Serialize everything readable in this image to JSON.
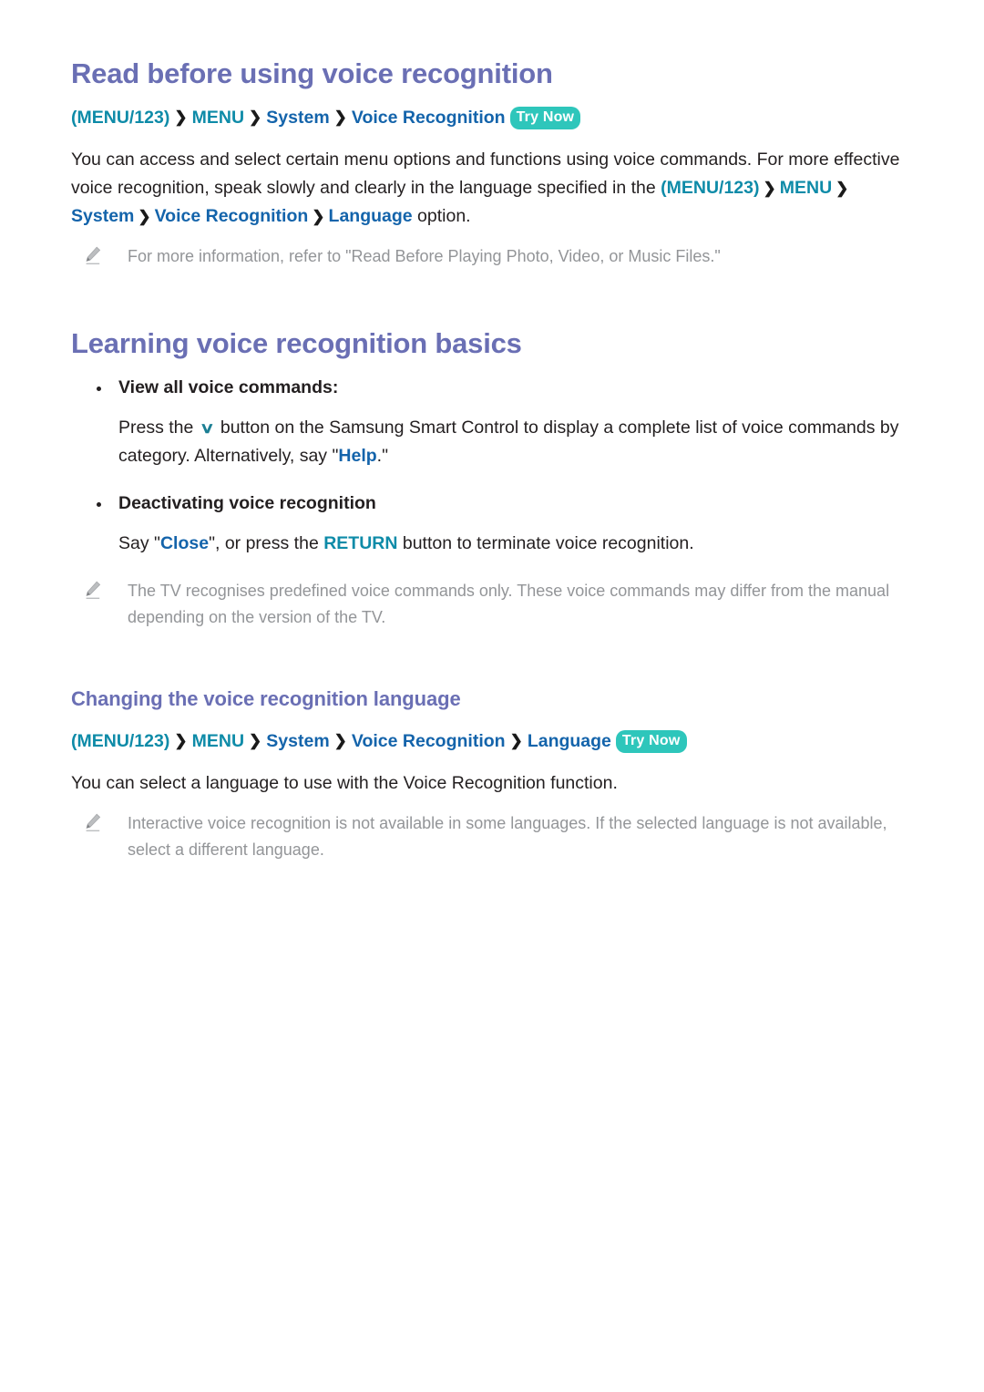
{
  "document": {
    "sections": [
      {
        "id": "read-before",
        "heading": "Read before using voice recognition",
        "breadcrumb": {
          "parts": [
            {
              "text": "(MENU/123)",
              "style": "teal"
            },
            {
              "text": "MENU",
              "style": "teal"
            },
            {
              "text": "System",
              "style": "blue"
            },
            {
              "text": "Voice Recognition",
              "style": "blue"
            }
          ],
          "separator": "❯",
          "badge": "Try Now"
        },
        "paragraph": {
          "lead": "You can access and select certain menu options and functions using voice commands. For more effective voice recognition, speak slowly and clearly in the language specified in the ",
          "path": [
            {
              "text": "(MENU/123)",
              "style": "teal"
            },
            {
              "text": "MENU",
              "style": "teal"
            },
            {
              "text": "System",
              "style": "blue"
            },
            {
              "text": "Voice Recognition",
              "style": "blue"
            },
            {
              "text": "Language",
              "style": "blue"
            }
          ],
          "tail": " option."
        },
        "note": "For more information, refer to \"Read Before Playing Photo, Video, or Music Files.\""
      },
      {
        "id": "learning-basics",
        "heading": "Learning voice recognition basics",
        "bullets": [
          {
            "label": "View all voice commands:",
            "body_before": "Press the ",
            "glyph": "∨",
            "body_mid": " button on the Samsung Smart Control to display a complete list of voice commands by category. Alternatively, say \"",
            "highlight": "Help",
            "highlight_style": "blue",
            "body_after": ".\""
          },
          {
            "label": "Deactivating voice recognition",
            "body_before": "Say \"",
            "highlight": "Close",
            "highlight_style": "blue",
            "body_mid": "\", or press the ",
            "highlight2": "RETURN",
            "highlight2_style": "teal",
            "body_after": " button to terminate voice recognition."
          }
        ],
        "note": "The TV recognises predefined voice commands only. These voice commands may differ from the manual depending on the version of the TV."
      },
      {
        "id": "changing-language",
        "heading": "Changing the voice recognition language",
        "breadcrumb": {
          "parts": [
            {
              "text": "(MENU/123)",
              "style": "teal"
            },
            {
              "text": "MENU",
              "style": "teal"
            },
            {
              "text": "System",
              "style": "blue"
            },
            {
              "text": "Voice Recognition",
              "style": "blue"
            },
            {
              "text": "Language",
              "style": "blue"
            }
          ],
          "separator": "❯",
          "badge": "Try Now"
        },
        "paragraph_plain": "You can select a language to use with the Voice Recognition function.",
        "note": "Interactive voice recognition is not available in some languages. If the selected language is not available, select a different language."
      }
    ]
  },
  "colors": {
    "heading": "#6a6fb4",
    "teal_link": "#0e8ba8",
    "blue_link": "#1464ab",
    "badge_bg": "#2ec6bb",
    "badge_fg": "#ffffff",
    "body_text": "#231f20",
    "note_text": "#939598",
    "chevron_glyph": "#1c7f94"
  },
  "icons": {
    "note": "pencil-icon",
    "separator": "chevron-right-icon",
    "dpad_down": "chevron-down-icon"
  }
}
